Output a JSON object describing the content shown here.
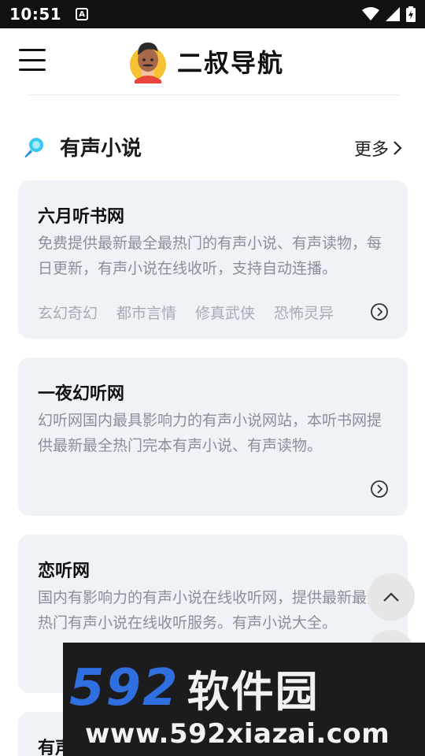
{
  "status_bar": {
    "time": "10:51",
    "notification_letter": "A"
  },
  "header": {
    "title": "二叔导航",
    "menu_icon": "hamburger-menu-icon",
    "logo_icon": "avatar-logo"
  },
  "section": {
    "title": "有声小说",
    "more_label": "更多",
    "icon": "magnifier-icon"
  },
  "cards": [
    {
      "title": "六月听书网",
      "description": "免费提供最新最全最热门的有声小说、有声读物，每日更新，有声小说在线收听，支持自动连播。",
      "tags": [
        "玄幻奇幻",
        "都市言情",
        "修真武侠",
        "恐怖灵异"
      ]
    },
    {
      "title": "一夜幻听网",
      "description": "幻听网国内最具影响力的有声小说网站，本听书网提供最新最全热门完本有声小说、有声读物。",
      "tags": []
    },
    {
      "title": "恋听网",
      "description": "国内有影响力的有声小说在线收听网，提供最新最全热门有声小说在线收听服务。有声小说大全。",
      "tags": []
    },
    {
      "title": "有声",
      "description": "",
      "tags": []
    }
  ],
  "watermark": {
    "brand_number": "592",
    "brand_name": "软件园",
    "url": "www.592xiazai.com"
  },
  "colors": {
    "card_bg": "#eff2f7",
    "muted_text": "#8a8f99",
    "tag_text": "#a6abb4",
    "brand_blue": "#2f6fe0"
  }
}
